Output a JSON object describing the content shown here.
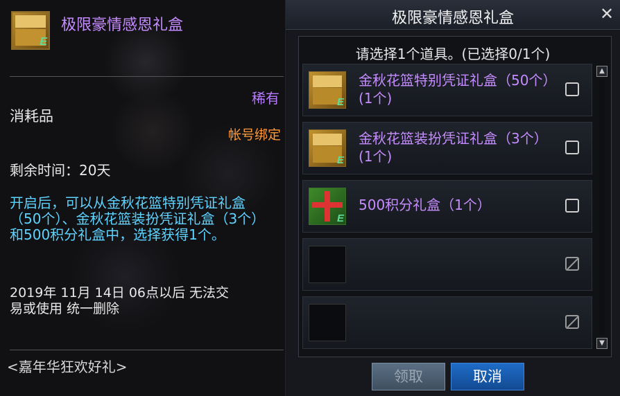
{
  "tooltip": {
    "title": "极限豪情感恩礼盒",
    "rarity": "稀有",
    "type": "消耗品",
    "binding": "帐号绑定",
    "remaining_time": "剩余时间：20天",
    "description": "开启后，可以从金秋花篮特别凭证礼盒（50个）、金秋花篮装扮凭证礼盒（3个）和500积分礼盒中，选择获得1个。",
    "expiry": "2019年 11月 14日 06点以后 无法交易或使用 统一删除",
    "set_name": "<嘉年华狂欢好礼>",
    "colors": {
      "title": "#c58cff",
      "rarity": "#b77bff",
      "binding": "#ff9a3a",
      "description": "#5fd3ff"
    }
  },
  "dialog": {
    "title": "极限豪情感恩礼盒",
    "prompt": "请选择1个道具。(已选择0/1个)",
    "items": [
      {
        "label": "金秋花篮特别凭证礼盒（50个）(1个)",
        "icon": "gold-chest-icon"
      },
      {
        "label": "金秋花篮装扮凭证礼盒（3个）(1个)",
        "icon": "gold-chest-icon"
      },
      {
        "label": "500积分礼盒（1个）",
        "icon": "green-gift-box-icon"
      },
      {
        "label": "",
        "icon": ""
      },
      {
        "label": "",
        "icon": ""
      }
    ],
    "buttons": {
      "claim": "领取",
      "cancel": "取消"
    }
  }
}
